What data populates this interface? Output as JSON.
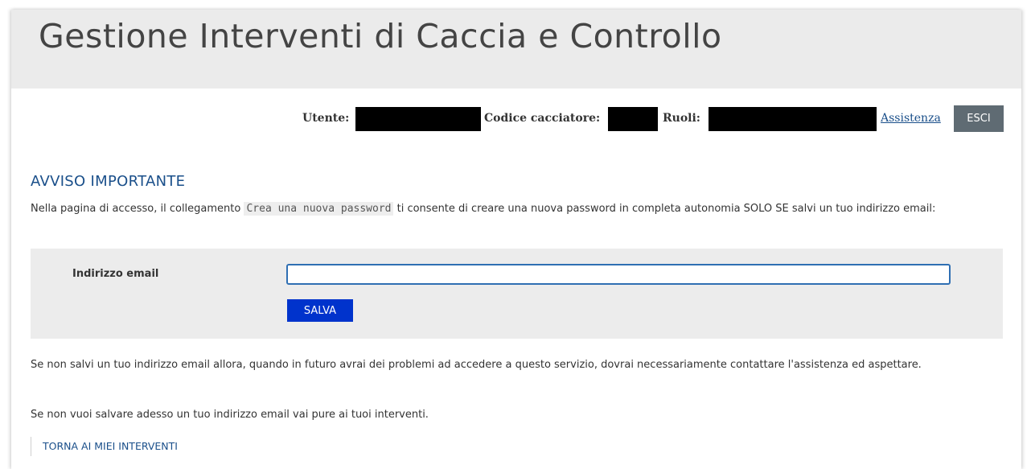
{
  "header": {
    "title": "Gestione Interventi di Caccia e Controllo"
  },
  "userbar": {
    "utente_label": "Utente:",
    "codice_label": "Codice cacciatore:",
    "ruoli_label": "Ruoli:",
    "assistenza_link": "Assistenza",
    "esci_button": "ESCI"
  },
  "notice": {
    "title": "AVVISO IMPORTANTE",
    "text_before": "Nella pagina di accesso, il collegamento ",
    "code": "Crea una nuova password",
    "text_after": " ti consente di creare una nuova password in completa autonomia SOLO SE salvi un tuo indirizzo email:"
  },
  "form": {
    "email_label": "Indirizzo email",
    "email_value": "",
    "save_button": "SALVA"
  },
  "info": {
    "warning": "Se non salvi un tuo indirizzo email allora, quando in futuro avrai dei problemi ad accedere a questo servizio, dovrai necessariamente contattare l'assistenza ed aspettare.",
    "skip": "Se non vuoi salvare adesso un tuo indirizzo email vai pure ai tuoi interventi.",
    "back_link": "TORNA AI MIEI INTERVENTI"
  },
  "colors": {
    "header_bg": "#ebebeb",
    "link": "#1a4f8a",
    "save_button_bg": "#0033cc",
    "esci_button_bg": "#5f6b73",
    "form_bg": "#ececec"
  }
}
